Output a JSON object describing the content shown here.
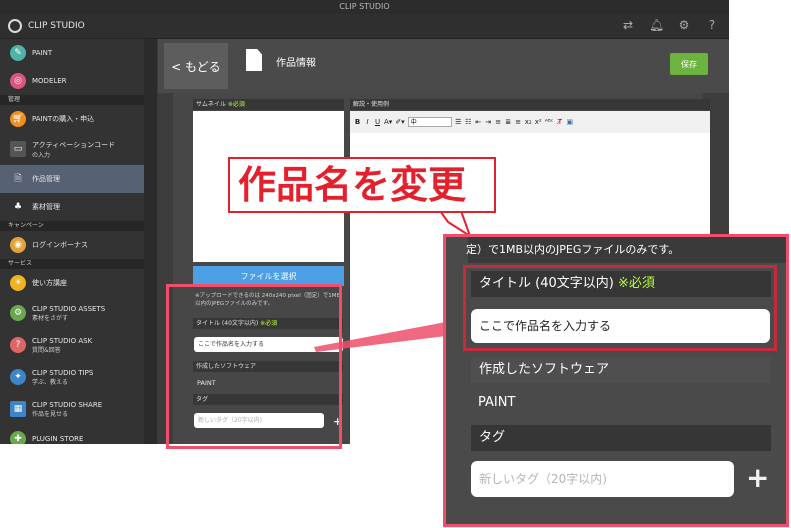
{
  "window": {
    "title": "CLIP STUDIO"
  },
  "topbar": {
    "brand": "CLIP STUDIO",
    "icons": [
      "sync-icon",
      "bell-icon",
      "gear-icon",
      "help-icon"
    ]
  },
  "sidebar": {
    "items_top": [
      {
        "label": "PAINT",
        "icon": "paint-icon",
        "color": "#4fb3a5"
      },
      {
        "label": "MODELER",
        "icon": "modeler-icon",
        "color": "#d9577e"
      }
    ],
    "section_manage": "管理",
    "items_manage": [
      {
        "label": "PAINTの購入・申込",
        "icon": "cart-icon",
        "color": "#f0901e"
      },
      {
        "label": "アクティベーションコード",
        "sub": "の入力",
        "icon": "card-icon",
        "color": "#555555"
      },
      {
        "label": "作品管理",
        "icon": "document-icon",
        "color": "#566273"
      },
      {
        "label": "素材管理",
        "icon": "materials-icon",
        "color": "#555555"
      }
    ],
    "section_campaign": "キャンペーン",
    "items_campaign": [
      {
        "label": "ログインボーナス",
        "icon": "bonus-icon",
        "color": "#e0a23b"
      }
    ],
    "section_service": "サービス",
    "items_service": [
      {
        "label": "使い方講座",
        "icon": "lightbulb-icon",
        "color": "#f0b21e"
      },
      {
        "label": "CLIP STUDIO ASSETS",
        "sub": "素材をさがす",
        "icon": "assets-icon",
        "color": "#6aa84f"
      },
      {
        "label": "CLIP STUDIO ASK",
        "sub": "質問&回答",
        "icon": "question-icon",
        "color": "#e06666"
      },
      {
        "label": "CLIP STUDIO TIPS",
        "sub": "学ぶ、教える",
        "icon": "tips-icon",
        "color": "#3d85c6"
      },
      {
        "label": "CLIP STUDIO SHARE",
        "sub": "作品を見せる",
        "icon": "share-icon",
        "color": "#3d85c6"
      },
      {
        "label": "PLUGIN STORE",
        "icon": "plugin-icon",
        "color": "#6aa84f"
      }
    ]
  },
  "header": {
    "back_label": "< もどる",
    "title": "作品情報",
    "save_label": "保存"
  },
  "form": {
    "thumbnail_label": "サムネイル",
    "required": "※必須",
    "file_button": "ファイルを選択",
    "upload_note": "※アップロードできるのは 240x240 pixel（固定）で1MB以内のJPEGファイルのみです。",
    "title_label": "タイトル (40文字以内)",
    "title_placeholder": "ここで作品名を入力する",
    "software_label": "作成したソフトウェア",
    "software_value": "PAINT",
    "tag_label": "タグ",
    "tag_placeholder": "新しいタグ（20字以内)",
    "desc_label": "解説・使用例",
    "toolbar": {
      "bold": "B",
      "italic": "I",
      "underline": "U",
      "font_size": "中"
    }
  },
  "callout": {
    "text": "作品名を変更"
  },
  "zoom": {
    "note": "定）で1MB以内のJPEGファイルのみです。",
    "title_label": "タイトル (40文字以内)",
    "required": "※必須",
    "title_placeholder": "ここで作品名を入力する",
    "software_label": "作成したソフトウェア",
    "software_value": "PAINT",
    "tag_label": "タグ",
    "tag_placeholder": "新しいタグ（20字以内)",
    "plus": "+"
  },
  "colors": {
    "accent_save": "#6db33f",
    "file_button": "#4d9fe6",
    "highlight": "#ef4f6a",
    "callout": "#e5202d",
    "required": "#b8ff3b"
  }
}
